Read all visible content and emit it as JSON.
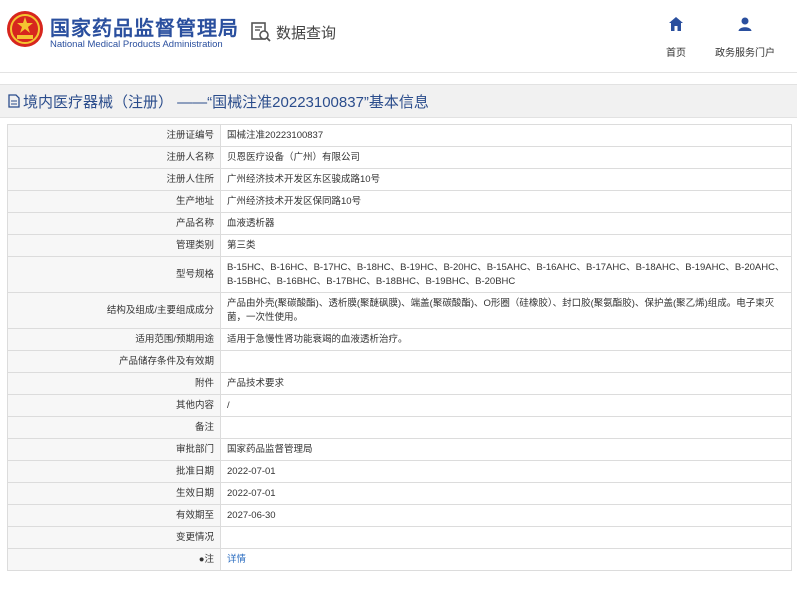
{
  "header": {
    "brand_cn": "国家药品监督管理局",
    "brand_en": "National Medical Products Administration",
    "query_label": "数据查询",
    "nav": [
      {
        "label": "首页",
        "icon": "home-icon"
      },
      {
        "label": "政务服务门户",
        "icon": "user-icon"
      }
    ]
  },
  "title": "境内医疗器械（注册） ——“国械注准20223100837”基本信息",
  "colors": {
    "brand": "#2a4f9e",
    "link": "#2a6cc0",
    "label_bg": "#f7f7f7"
  },
  "rows": [
    {
      "label": "注册证编号",
      "value": "国械注准20223100837"
    },
    {
      "label": "注册人名称",
      "value": "贝恩医疗设备（广州）有限公司"
    },
    {
      "label": "注册人住所",
      "value": "广州经济技术开发区东区骏成路10号"
    },
    {
      "label": "生产地址",
      "value": "广州经济技术开发区保同路10号"
    },
    {
      "label": "产品名称",
      "value": "血液透析器"
    },
    {
      "label": "管理类别",
      "value": "第三类"
    },
    {
      "label": "型号规格",
      "value": "B-15HC、B-16HC、B-17HC、B-18HC、B-19HC、B-20HC、B-15AHC、B-16AHC、B-17AHC、B-18AHC、B-19AHC、B-20AHC、B-15BHC、B-16BHC、B-17BHC、B-18BHC、B-19BHC、B-20BHC"
    },
    {
      "label": "结构及组成/主要组成成分",
      "value": "产品由外壳(聚碳酸酯)、透析膜(聚醚砜膜)、端盖(聚碳酸酯)、O形圈（硅橡胶）、封口胶(聚氨酯胶)、保护盖(聚乙烯)组成。电子束灭菌，一次性使用。"
    },
    {
      "label": "适用范围/预期用途",
      "value": "适用于急慢性肾功能衰竭的血液透析治疗。"
    },
    {
      "label": "产品储存条件及有效期",
      "value": ""
    },
    {
      "label": "附件",
      "value": "产品技术要求"
    },
    {
      "label": "其他内容",
      "value": "/"
    },
    {
      "label": "备注",
      "value": ""
    },
    {
      "label": "审批部门",
      "value": "国家药品监督管理局"
    },
    {
      "label": "批准日期",
      "value": "2022-07-01"
    },
    {
      "label": "生效日期",
      "value": "2022-07-01"
    },
    {
      "label": "有效期至",
      "value": "2027-06-30"
    },
    {
      "label": "变更情况",
      "value": ""
    },
    {
      "label": "●注",
      "value": "详情"
    }
  ]
}
